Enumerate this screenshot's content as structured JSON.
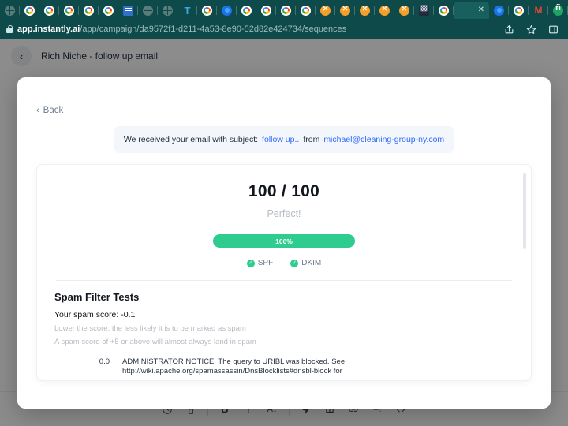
{
  "browser": {
    "url": {
      "domain": "app.instantly.ai",
      "path": "/app/campaign/da9572f1-d211-4a53-8e90-52d82e424734/sequences",
      "lock_icon": "lock-icon"
    },
    "toolbar_icons": [
      "share-icon",
      "bookmark-star-icon",
      "side-panel-icon"
    ],
    "tabs": [
      {
        "favicon": "globe-icon",
        "active": false
      },
      {
        "favicon": "google-icon",
        "active": false
      },
      {
        "favicon": "google-icon",
        "active": false
      },
      {
        "favicon": "google-icon",
        "active": false
      },
      {
        "favicon": "google-icon",
        "active": false
      },
      {
        "favicon": "google-icon",
        "active": false
      },
      {
        "favicon": "google-docs-icon",
        "active": false
      },
      {
        "favicon": "globe-icon",
        "active": false
      },
      {
        "favicon": "globe-icon",
        "active": false
      },
      {
        "favicon": "letter-t-icon",
        "active": false
      },
      {
        "favicon": "google-icon",
        "active": false
      },
      {
        "favicon": "blue-gear-icon",
        "active": false
      },
      {
        "favicon": "google-icon",
        "active": false
      },
      {
        "favicon": "google-icon",
        "active": false
      },
      {
        "favicon": "google-icon",
        "active": false
      },
      {
        "favicon": "google-icon",
        "active": false
      },
      {
        "favicon": "orange-x-icon",
        "active": false
      },
      {
        "favicon": "orange-x-icon",
        "active": false
      },
      {
        "favicon": "orange-x-icon",
        "active": false
      },
      {
        "favicon": "orange-x-icon",
        "active": false
      },
      {
        "favicon": "orange-x-icon",
        "active": false
      },
      {
        "favicon": "dark-grid-icon",
        "active": false
      },
      {
        "favicon": "google-icon",
        "active": false
      },
      {
        "favicon": "blank-icon",
        "active": true,
        "close_label": "✕"
      },
      {
        "favicon": "blue-gear-icon",
        "active": false
      },
      {
        "favicon": "google-icon",
        "active": false
      },
      {
        "favicon": "gmail-icon",
        "active": false
      },
      {
        "favicon": "green-app-icon",
        "active": false
      },
      {
        "favicon": "cyan-globe-icon",
        "active": false
      }
    ]
  },
  "breadcrumb": {
    "back_icon": "chevron-left-icon",
    "title": "Rich Niche - follow up email"
  },
  "modal": {
    "back_label": "Back",
    "back_chevron": "‹",
    "subject_banner": {
      "prefix": "We received your email with subject:",
      "subject": "follow up..",
      "middle": "from",
      "sender": "michael@cleaning-group-ny.com"
    },
    "score": {
      "value": "100 / 100",
      "label": "Perfect!",
      "bar_percent_label": "100%",
      "bar_percent": 100,
      "bar_color": "#2ecc8f"
    },
    "auth_checks": [
      {
        "name": "SPF",
        "status_icon": "check-circle-icon",
        "passed": true
      },
      {
        "name": "DKIM",
        "status_icon": "check-circle-icon",
        "passed": true
      }
    ],
    "spam_filter": {
      "heading": "Spam Filter Tests",
      "score_line": "Your spam score: -0.1",
      "hint_1": "Lower the score, the less likely it is to be marked as spam",
      "hint_2": "A spam score of +5 or above will almost always land in spam",
      "rows": [
        {
          "score": "0.0",
          "description": "ADMINISTRATOR NOTICE: The query to URIBL was blocked. See http://wiki.apache.org/spamassassin/DnsBlocklists#dnsbl-block for"
        }
      ]
    }
  },
  "editor_toolbar": {
    "groups": [
      [
        {
          "icon": "clock-icon",
          "label": ""
        },
        {
          "icon": "paint-roller-icon",
          "label": ""
        }
      ],
      [
        {
          "icon": "bold-icon",
          "label": "B"
        },
        {
          "icon": "italic-icon",
          "label": "i"
        },
        {
          "icon": "font-size-icon",
          "label": "A"
        }
      ],
      [
        {
          "icon": "lightning-icon",
          "label": ""
        },
        {
          "icon": "image-icon",
          "label": ""
        },
        {
          "icon": "link-icon",
          "label": ""
        },
        {
          "icon": "insert-plus-icon",
          "label": ""
        },
        {
          "icon": "code-icon",
          "label": ""
        }
      ]
    ]
  }
}
